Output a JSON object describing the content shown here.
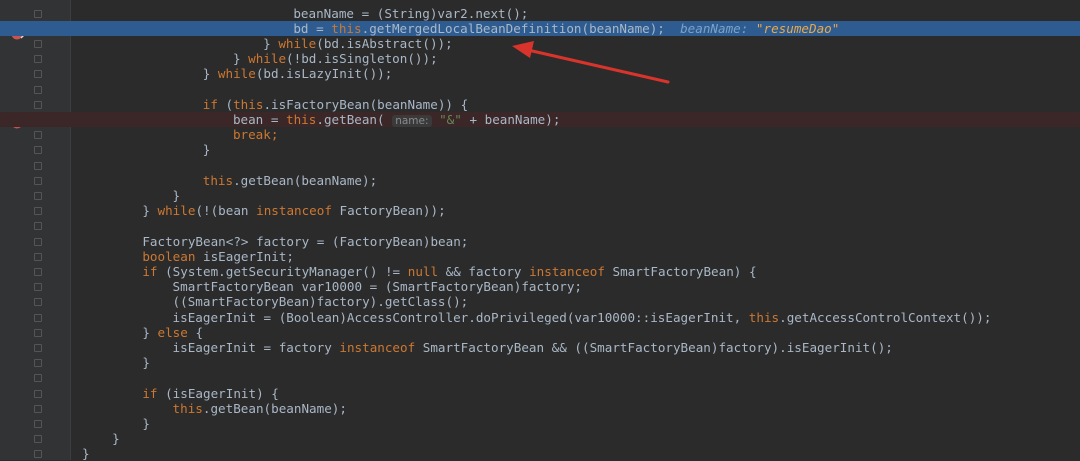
{
  "editor": {
    "debug": {
      "inline_label": "beanName:",
      "inline_value": "\"resumeDao\""
    },
    "hint": {
      "name": "name:"
    },
    "lines": [
      {
        "indent": 37,
        "parts": [
          [
            "t",
            "beanName = (String)var2.next();"
          ]
        ]
      },
      {
        "indent": 37,
        "current": true,
        "parts": [
          [
            "t",
            "bd = "
          ],
          [
            "k",
            "this"
          ],
          [
            "t",
            ".getMergedLocalBeanDefinition(beanName);"
          ]
        ]
      },
      {
        "indent": 33,
        "parts": [
          [
            "t",
            "} "
          ],
          [
            "k",
            "while"
          ],
          [
            "t",
            "(bd.isAbstract());"
          ]
        ]
      },
      {
        "indent": 29,
        "parts": [
          [
            "t",
            "} "
          ],
          [
            "k",
            "while"
          ],
          [
            "t",
            "(!bd.isSingleton());"
          ]
        ]
      },
      {
        "indent": 25,
        "parts": [
          [
            "t",
            "} "
          ],
          [
            "k",
            "while"
          ],
          [
            "t",
            "(bd.isLazyInit());"
          ]
        ]
      },
      {
        "indent": 0,
        "parts": []
      },
      {
        "indent": 25,
        "parts": [
          [
            "k",
            "if"
          ],
          [
            "t",
            " ("
          ],
          [
            "k",
            "this"
          ],
          [
            "t",
            ".isFactoryBean(beanName)) {"
          ]
        ]
      },
      {
        "indent": 29,
        "bp": true,
        "parts": [
          [
            "t",
            "bean = "
          ],
          [
            "k",
            "this"
          ],
          [
            "t",
            ".getBean( "
          ],
          [
            "h",
            "name:"
          ],
          [
            "s",
            " \"&\""
          ],
          [
            "t",
            " + beanName);"
          ]
        ]
      },
      {
        "indent": 29,
        "parts": [
          [
            "k",
            "break"
          ],
          [
            "k",
            ";"
          ]
        ]
      },
      {
        "indent": 25,
        "parts": [
          [
            "t",
            "}"
          ]
        ]
      },
      {
        "indent": 0,
        "parts": []
      },
      {
        "indent": 25,
        "parts": [
          [
            "k",
            "this"
          ],
          [
            "t",
            ".getBean(beanName);"
          ]
        ]
      },
      {
        "indent": 21,
        "parts": [
          [
            "t",
            "}"
          ]
        ]
      },
      {
        "indent": 17,
        "parts": [
          [
            "t",
            "} "
          ],
          [
            "k",
            "while"
          ],
          [
            "t",
            "(!(bean "
          ],
          [
            "k",
            "instanceof"
          ],
          [
            "t",
            " FactoryBean));"
          ]
        ]
      },
      {
        "indent": 0,
        "parts": []
      },
      {
        "indent": 17,
        "parts": [
          [
            "t",
            "FactoryBean<?> factory = (FactoryBean)bean;"
          ]
        ]
      },
      {
        "indent": 17,
        "parts": [
          [
            "k",
            "boolean"
          ],
          [
            "t",
            " isEagerInit;"
          ]
        ]
      },
      {
        "indent": 17,
        "parts": [
          [
            "k",
            "if"
          ],
          [
            "t",
            " (System.getSecurityManager() != "
          ],
          [
            "k",
            "null"
          ],
          [
            "t",
            " && factory "
          ],
          [
            "k",
            "instanceof"
          ],
          [
            "t",
            " SmartFactoryBean) {"
          ]
        ]
      },
      {
        "indent": 21,
        "parts": [
          [
            "t",
            "SmartFactoryBean var10000 = (SmartFactoryBean)factory;"
          ]
        ]
      },
      {
        "indent": 21,
        "parts": [
          [
            "t",
            "((SmartFactoryBean)factory).getClass();"
          ]
        ]
      },
      {
        "indent": 21,
        "parts": [
          [
            "t",
            "isEagerInit = (Boolean)AccessController.doPrivileged(var10000::isEagerInit, "
          ],
          [
            "k",
            "this"
          ],
          [
            "t",
            ".getAccessControlContext());"
          ]
        ]
      },
      {
        "indent": 17,
        "parts": [
          [
            "t",
            "} "
          ],
          [
            "k",
            "else"
          ],
          [
            "t",
            " {"
          ]
        ]
      },
      {
        "indent": 21,
        "parts": [
          [
            "t",
            "isEagerInit = factory "
          ],
          [
            "k",
            "instanceof"
          ],
          [
            "t",
            " SmartFactoryBean && ((SmartFactoryBean)factory).isEagerInit();"
          ]
        ]
      },
      {
        "indent": 17,
        "parts": [
          [
            "t",
            "}"
          ]
        ]
      },
      {
        "indent": 0,
        "parts": []
      },
      {
        "indent": 17,
        "parts": [
          [
            "k",
            "if"
          ],
          [
            "t",
            " (isEagerInit) {"
          ]
        ]
      },
      {
        "indent": 21,
        "parts": [
          [
            "k",
            "this"
          ],
          [
            "t",
            ".getBean(beanName);"
          ]
        ]
      },
      {
        "indent": 17,
        "parts": [
          [
            "t",
            "}"
          ]
        ]
      },
      {
        "indent": 13,
        "parts": [
          [
            "t",
            "}"
          ]
        ]
      },
      {
        "indent": 9,
        "parts": [
          [
            "t",
            "}"
          ]
        ]
      }
    ]
  },
  "colors": {
    "background": "#2b2b2b",
    "current_line": "#2e5c91",
    "breakpoint_line": "#3b2727",
    "keyword": "#cc7832",
    "string": "#6a8759",
    "arrow": "#d9342b"
  },
  "icons": [
    "breakpoint-icon",
    "debug-breakpoint-icon",
    "lightbulb-icon",
    "fold-marker-icon",
    "annotation-arrow"
  ]
}
